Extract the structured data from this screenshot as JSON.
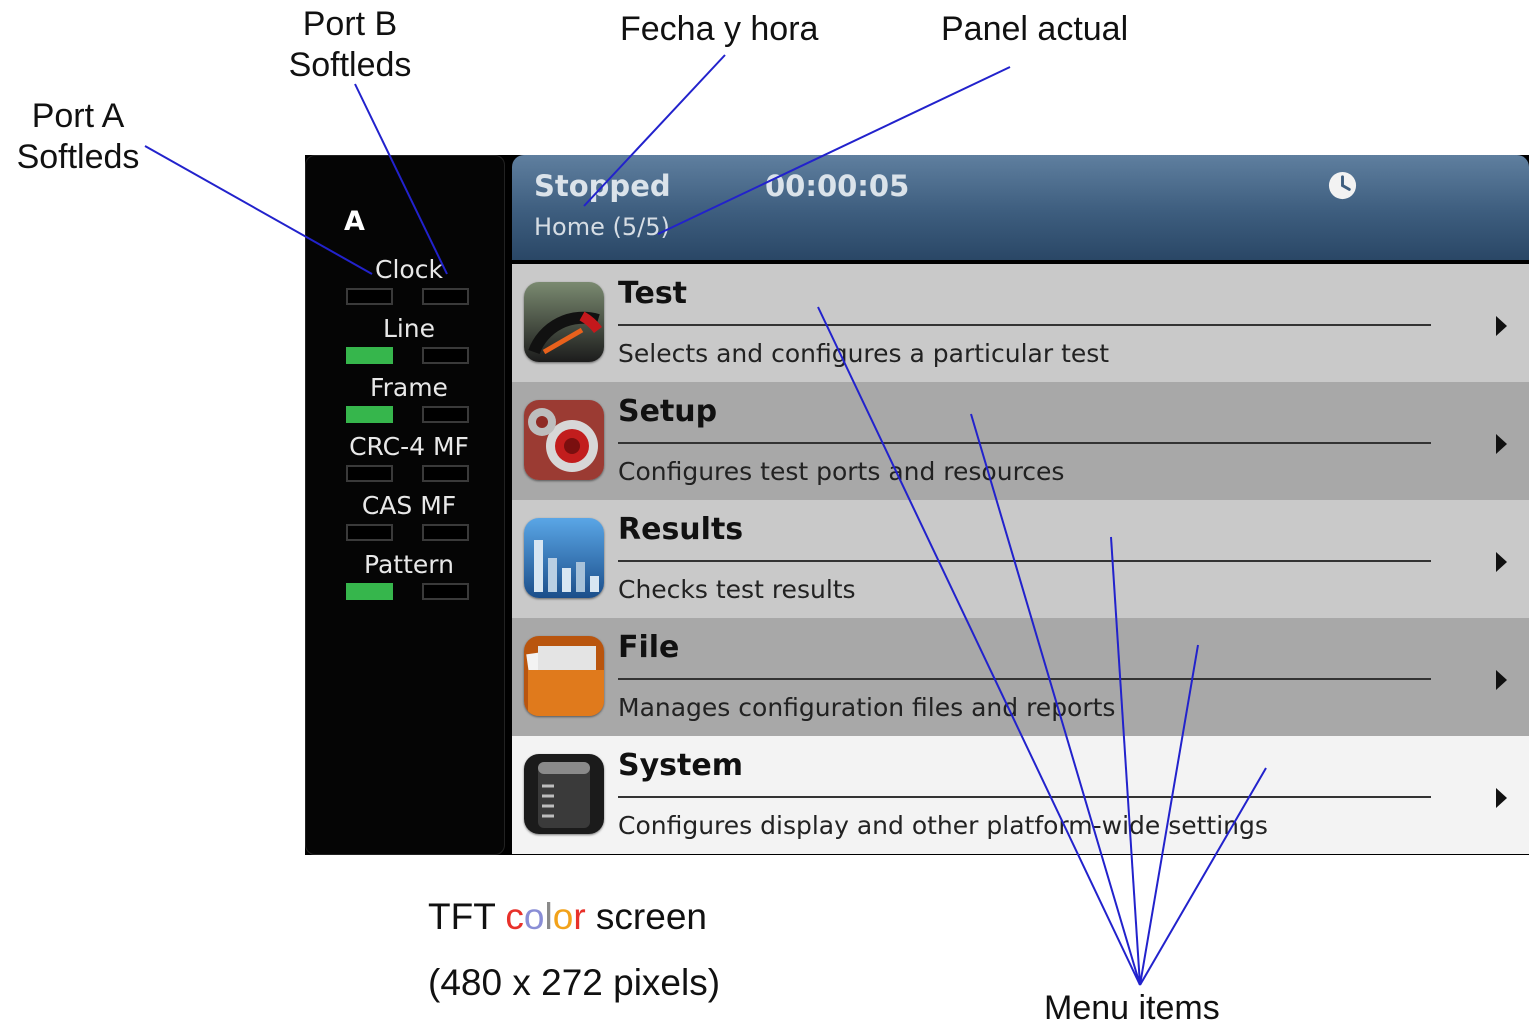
{
  "callouts": {
    "port_b_line1": "Port B",
    "port_b_line2": "Softleds",
    "port_a_line1": "Port A",
    "port_a_line2": "Softleds",
    "fecha_hora": "Fecha y hora",
    "panel_actual": "Panel actual",
    "menu_items": "Menu items"
  },
  "caption": {
    "pre": "TFT ",
    "color_letters": [
      {
        "ch": "c",
        "color": "#e8312a"
      },
      {
        "ch": "o",
        "color": "#8a8ed6"
      },
      {
        "ch": "l",
        "color": "#8a8a8a"
      },
      {
        "ch": "o",
        "color": "#f2a21a"
      },
      {
        "ch": "r",
        "color": "#e8312a"
      }
    ],
    "post": " screen",
    "line2": "(480 x 272 pixels)"
  },
  "colors": {
    "led_on": "#36b64c",
    "header_top": "#5f7f9f",
    "header_bottom": "#2a4766",
    "leader_lines": "#2222cc"
  },
  "softleds": {
    "port": "A",
    "rows": [
      {
        "label": "Clock",
        "port_a": false,
        "port_b": false
      },
      {
        "label": "Line",
        "port_a": true,
        "port_b": false
      },
      {
        "label": "Frame",
        "port_a": true,
        "port_b": false
      },
      {
        "label": "CRC-4 MF",
        "port_a": false,
        "port_b": false
      },
      {
        "label": "CAS MF",
        "port_a": false,
        "port_b": false
      },
      {
        "label": "Pattern",
        "port_a": true,
        "port_b": false
      }
    ]
  },
  "header": {
    "status": "Stopped",
    "elapsed": "00:00:05",
    "panel": "Home (5/5)",
    "icon": "clock-icon"
  },
  "menu": [
    {
      "title": "Test",
      "description": "Selects and configures a particular test",
      "icon": "gauge-icon"
    },
    {
      "title": "Setup",
      "description": "Configures test ports and resources",
      "icon": "gears-icon"
    },
    {
      "title": "Results",
      "description": "Checks test results",
      "icon": "bar-chart-icon"
    },
    {
      "title": "File",
      "description": "Manages configuration files and reports",
      "icon": "folder-icon"
    },
    {
      "title": "System",
      "description": "Configures display and other platform-wide settings",
      "icon": "system-icon"
    }
  ]
}
